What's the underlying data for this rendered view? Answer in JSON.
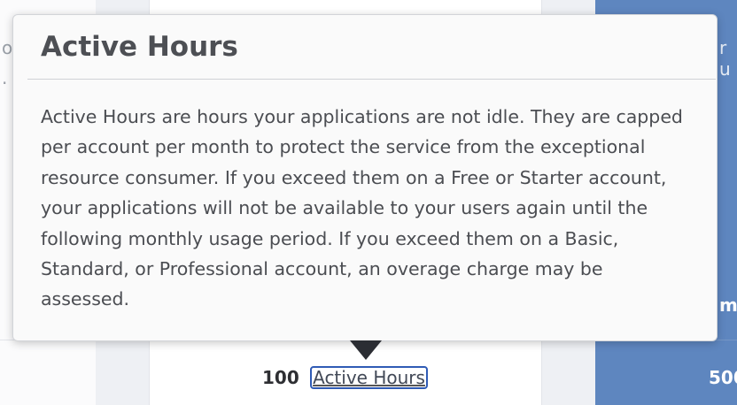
{
  "background": {
    "left_fragment_1": "o",
    "left_fragment_2": ".",
    "right_fragment_1": "r u",
    "right_fragment_2": "m",
    "right_fragment_3": "500"
  },
  "plan": {
    "hours_value": "100",
    "hours_link_label": "Active Hours"
  },
  "tooltip": {
    "title": "Active Hours",
    "body": "Active Hours are hours your applications are not idle. They are capped per account per month to protect the service from the exceptional resource consumer. If you exceed them on a Free or Starter account, your applications will not be available to your users again until the following monthly usage period. If you exceed them on a Basic, Standard, or Professional account, an overage charge may be assessed."
  },
  "colors": {
    "accent_column": "#5e86bf",
    "focus_ring": "#2f5bb5",
    "tooltip_bg": "#fafafa",
    "tooltip_arrow": "#2b2d33"
  }
}
